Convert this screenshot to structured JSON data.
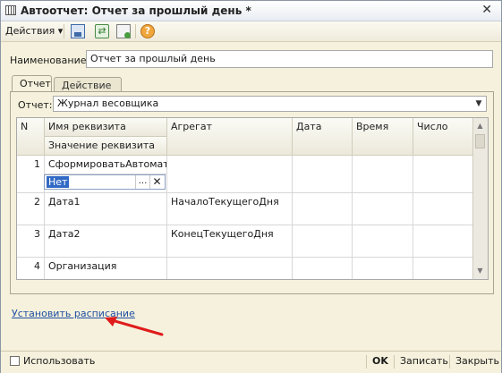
{
  "window": {
    "title": "Автоотчет: Отчет за прошлый день *",
    "close": "✕"
  },
  "toolbar": {
    "actions_label": "Действия",
    "dropdown_glyph": "▾"
  },
  "name_field": {
    "label": "Наименование:",
    "value": "Отчет за прошлый день"
  },
  "tabs": [
    {
      "label": "Отчет",
      "active": true
    },
    {
      "label": "Действие",
      "active": false
    }
  ],
  "report_field": {
    "label": "Отчет:",
    "value": "Журнал весовщика"
  },
  "table": {
    "headers": {
      "n": "N",
      "name": "Имя реквизита",
      "value_sub": "Значение реквизита",
      "aggregate": "Агрегат",
      "date": "Дата",
      "time": "Время",
      "number": "Число"
    },
    "rows": [
      {
        "n": "1",
        "name": "СформироватьАвтомат...",
        "value": "Нет",
        "aggregate": ""
      },
      {
        "n": "2",
        "name": "Дата1",
        "value": "",
        "aggregate": "НачалоТекущегоДня"
      },
      {
        "n": "3",
        "name": "Дата2",
        "value": "",
        "aggregate": "КонецТекущегоДня"
      },
      {
        "n": "4",
        "name": "Организация",
        "value": "",
        "aggregate": ""
      }
    ],
    "edit_glyphs": {
      "choose": "...",
      "clear": "✕"
    }
  },
  "schedule_link": "Установить расписание",
  "footer": {
    "use_checkbox_label": "Использовать",
    "ok": "OK",
    "save": "Записать",
    "close": "Закрыть"
  },
  "icons": [
    "app-window-icon",
    "close-icon",
    "save-icon",
    "refresh-icon",
    "copy-icon",
    "help-icon"
  ],
  "colors": {
    "background": "#f5f1dc",
    "selection": "#316ac5",
    "link": "#1f4fa3",
    "arrow": "#e01b1b"
  }
}
